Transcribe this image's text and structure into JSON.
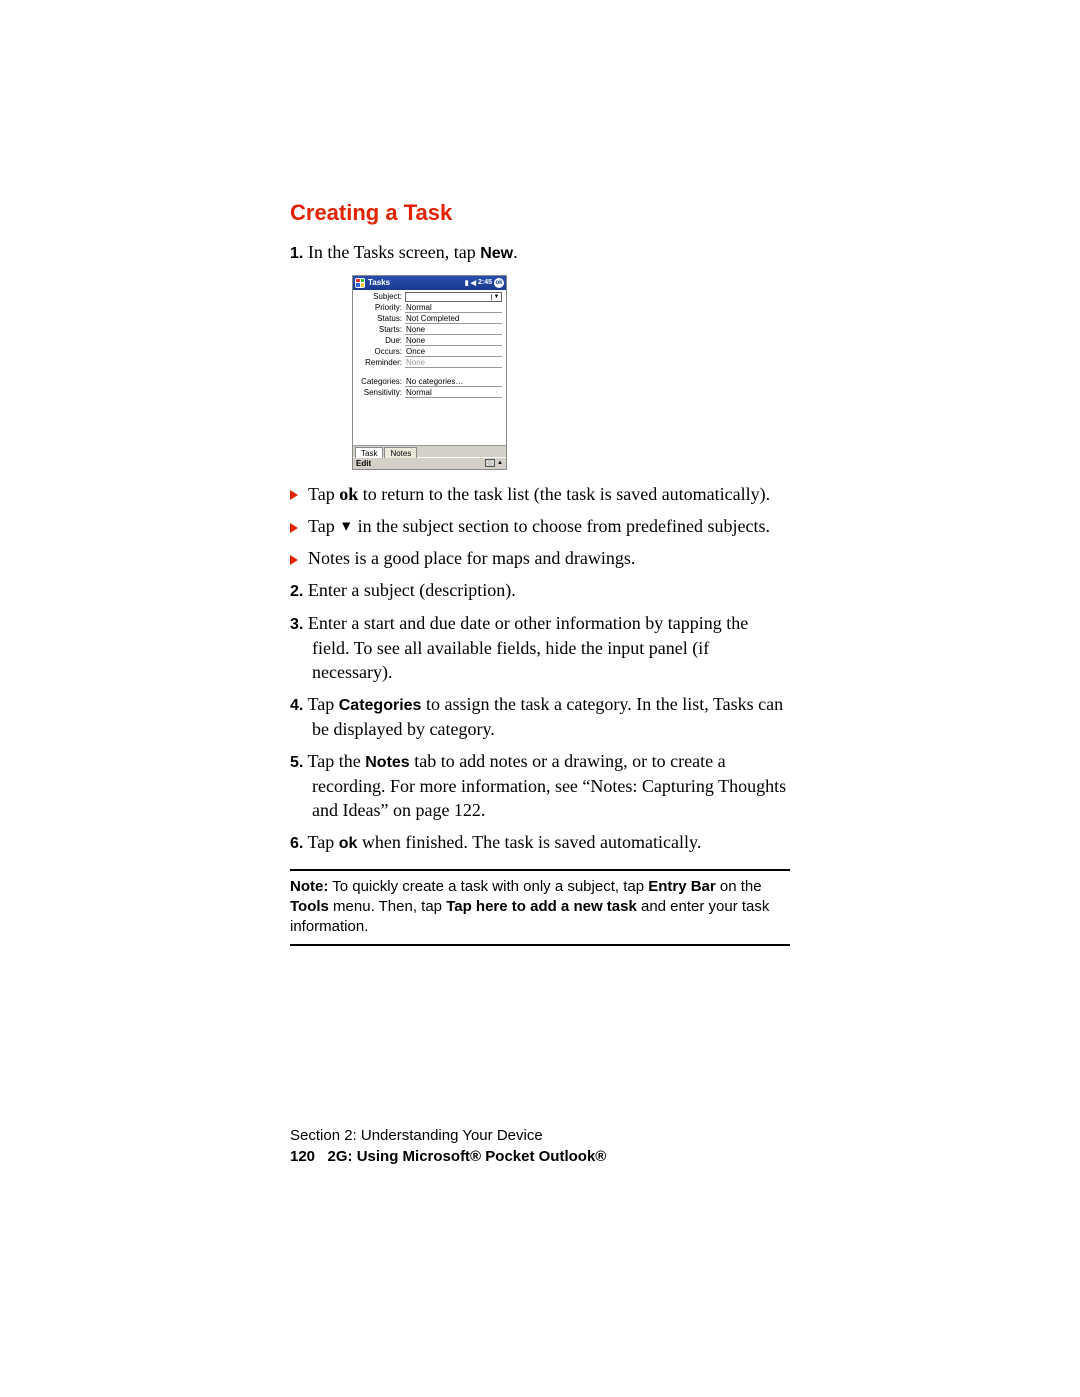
{
  "heading": "Creating a Task",
  "steps": {
    "s1": {
      "num": "1.",
      "text_before": " In the Tasks screen, tap ",
      "bold": "New",
      "text_after": "."
    },
    "s2": {
      "num": "2.",
      "text": " Enter a subject (description)."
    },
    "s3": {
      "num": "3.",
      "text": " Enter a start and due date or other information by tapping the field. To see all available fields, hide the input panel (if necessary)."
    },
    "s4": {
      "num": "4.",
      "before": " Tap ",
      "bold": "Categories",
      "after": " to assign the task a category. In the list, Tasks can be displayed by category."
    },
    "s5": {
      "num": "5.",
      "before": " Tap the ",
      "bold": "Notes",
      "after": " tab to add notes or a drawing, or to create a recording. For more information, see “Notes: Capturing Thoughts and Ideas” on page 122."
    },
    "s6": {
      "num": "6.",
      "before": " Tap ",
      "bold": "ok",
      "after": " when finished. The task is saved automatically."
    }
  },
  "bullets": {
    "b1": {
      "before": "Tap ",
      "bold": "ok",
      "after": " to return to the task list (the task is saved automatically)."
    },
    "b2": {
      "before": "Tap ",
      "glyph": "▼",
      "after": " in the subject section to choose from predefined subjects."
    },
    "b3": {
      "text": "Notes is a good place for maps and drawings."
    }
  },
  "note": {
    "label": "Note:",
    "t1": " To quickly create a task with only a subject, tap ",
    "b1": "Entry Bar",
    "t2": " on the ",
    "b2": "Tools",
    "t3": " menu. Then, tap ",
    "b3": "Tap here to add a new task",
    "t4": " and enter your task information."
  },
  "footer": {
    "section": "Section 2: Understanding Your Device",
    "page": "120",
    "chapter": "2G: Using Microsoft® Pocket Outlook®"
  },
  "deviceShot": {
    "title": "Tasks",
    "time": "2:45",
    "ok": "ok",
    "labels": {
      "subject": "Subject:",
      "priority": "Priority:",
      "status": "Status:",
      "starts": "Starts:",
      "due": "Due:",
      "occurs": "Occurs:",
      "reminder": "Reminder:",
      "categories": "Categories:",
      "sensitivity": "Sensitivity:"
    },
    "values": {
      "priority": "Normal",
      "status": "Not Completed",
      "starts": "None",
      "due": "None",
      "occurs": "Once",
      "reminder": "None",
      "categories": "No categories…",
      "sensitivity": "Normal"
    },
    "tabs": {
      "task": "Task",
      "notes": "Notes"
    },
    "edit": "Edit"
  }
}
